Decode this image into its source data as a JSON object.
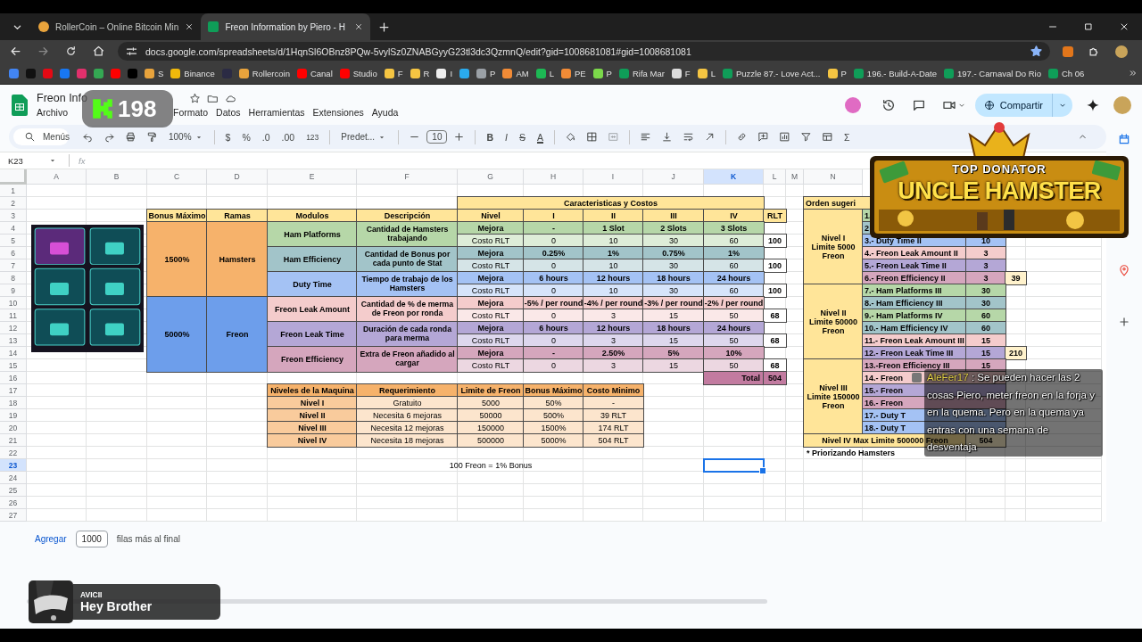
{
  "browser": {
    "tabs": [
      {
        "title": "RollerCoin – Online Bitcoin Min",
        "selected": false
      },
      {
        "title": "Freon Information by Piero - H",
        "selected": true
      }
    ],
    "url": "docs.google.com/spreadsheets/d/1HqnSl6OBnz8PQw-5vylSz0ZNABGyyG23tl3dc3QzmnQ/edit?gid=1008681081#gid=1008681081",
    "bookmarks": [
      {
        "color": "#4285f4"
      },
      {
        "color": "#111111"
      },
      {
        "color": "#e50914"
      },
      {
        "color": "#1877f2"
      },
      {
        "color": "#e1306c"
      },
      {
        "color": "#34a853"
      },
      {
        "color": "#ff0000"
      },
      {
        "color": "#000000"
      },
      {
        "label": "S",
        "color": "#e8a33c"
      },
      {
        "label": "Binance",
        "color": "#f0b90b"
      },
      {
        "color": "#2b2b44"
      },
      {
        "label": "Rollercoin",
        "color": "#e8a33c"
      },
      {
        "label": "Canal",
        "color": "#ff0000"
      },
      {
        "label": "Studio",
        "color": "#ff0000"
      },
      {
        "label": "F",
        "color": "#f5c542"
      },
      {
        "label": "R",
        "color": "#f5c542"
      },
      {
        "label": "I",
        "color": "#eeeeee"
      },
      {
        "color": "#2aabee"
      },
      {
        "label": "P",
        "color": "#9aa0a6"
      },
      {
        "label": "AM",
        "color": "#f28b36"
      },
      {
        "label": "L",
        "color": "#1db954"
      },
      {
        "label": "PE",
        "color": "#f28b36"
      },
      {
        "label": "P",
        "color": "#7bd84a"
      },
      {
        "label": "Rifa Mar",
        "color": "#0f9d58"
      },
      {
        "label": "F",
        "color": "#dddddd"
      },
      {
        "label": "L",
        "color": "#f5c542"
      },
      {
        "label": "Puzzle 87.- Love Act...",
        "color": "#0f9d58"
      },
      {
        "label": "P",
        "color": "#f5c542"
      },
      {
        "label": "196.- Build-A-Date",
        "color": "#0f9d58"
      },
      {
        "label": "197.- Carnaval Do Rio",
        "color": "#0f9d58"
      },
      {
        "label": "Ch 06",
        "color": "#0f9d58"
      }
    ]
  },
  "doc": {
    "title": "Freon Info",
    "menus": [
      "Archivo",
      "Formato",
      "Datos",
      "Herramientas",
      "Extensiones",
      "Ayuda"
    ],
    "share_button": "Compartir"
  },
  "toolbar": {
    "search": "Menús",
    "zoom": "100%",
    "currency": "$",
    "percent": "%",
    "decrease_decimals": ".0",
    "increase_decimals": ".00",
    "number_format": "123",
    "font": "Predet...",
    "font_size": "10",
    "bold": "B",
    "italic": "I",
    "strikethrough": "S",
    "text_color": "A",
    "functions": "Σ"
  },
  "formula_bar": {
    "name_box": "K23",
    "formula_label": "fx"
  },
  "sheet": {
    "columns": [
      {
        "label": "A",
        "selected": false
      },
      {
        "label": "B",
        "selected": false
      },
      {
        "label": "C",
        "selected": false
      },
      {
        "label": "D",
        "selected": false
      },
      {
        "label": "E",
        "selected": false
      },
      {
        "label": "F",
        "selected": false
      },
      {
        "label": "G",
        "selected": false
      },
      {
        "label": "H",
        "selected": false
      },
      {
        "label": "I",
        "selected": false
      },
      {
        "label": "J",
        "selected": false
      },
      {
        "label": "K",
        "selected": true
      },
      {
        "label": "L",
        "selected": false
      },
      {
        "label": "M",
        "selected": false
      },
      {
        "label": "N",
        "selected": false
      }
    ],
    "rows": [
      {
        "label": "1",
        "selected": false
      },
      {
        "label": "2",
        "selected": false
      },
      {
        "label": "3",
        "selected": false
      },
      {
        "label": "4",
        "selected": false
      },
      {
        "label": "5",
        "selected": false
      },
      {
        "label": "6",
        "selected": false
      },
      {
        "label": "7",
        "selected": false
      },
      {
        "label": "8",
        "selected": false
      },
      {
        "label": "9",
        "selected": false
      },
      {
        "label": "10",
        "selected": false
      },
      {
        "label": "11",
        "selected": false
      },
      {
        "label": "12",
        "selected": false
      },
      {
        "label": "13",
        "selected": false
      },
      {
        "label": "14",
        "selected": false
      },
      {
        "label": "15",
        "selected": false
      },
      {
        "label": "16",
        "selected": false
      },
      {
        "label": "17",
        "selected": false
      },
      {
        "label": "18",
        "selected": false
      },
      {
        "label": "19",
        "selected": false
      },
      {
        "label": "20",
        "selected": false
      },
      {
        "label": "21",
        "selected": false
      },
      {
        "label": "22",
        "selected": false
      },
      {
        "label": "23",
        "selected": true
      },
      {
        "label": "24",
        "selected": false
      },
      {
        "label": "25",
        "selected": false
      },
      {
        "label": "26",
        "selected": false
      },
      {
        "label": "27",
        "selected": false
      }
    ]
  },
  "main_table": {
    "title": "Caracteristicas y Costos",
    "columns": [
      "Bonus Máximo",
      "Ramas",
      "Modulos",
      "Descripción",
      "Nivel",
      "I",
      "II",
      "III",
      "IV",
      "RLT"
    ],
    "branches": [
      {
        "bonus": "1500%",
        "name": "Hamsters",
        "color": "#f6b26b",
        "modules": [
          {
            "name": "Ham Platforms",
            "description": "Cantidad de Hamsters trabajando",
            "color": "#b6d7a8",
            "upgrade_label": "Mejora",
            "upgrades": [
              "-",
              "1 Slot",
              "2 Slots",
              "3 Slots"
            ],
            "cost_label": "Costo RLT",
            "costs": [
              "0",
              "10",
              "30",
              "60"
            ],
            "total": "100"
          },
          {
            "name": "Ham Efficiency",
            "description": "Cantidad de Bonus por cada punto de Stat",
            "color": "#a2c4c9",
            "upgrade_label": "Mejora",
            "upgrades": [
              "0.25%",
              "1%",
              "0.75%",
              "1%"
            ],
            "cost_label": "Costo RLT",
            "costs": [
              "0",
              "10",
              "30",
              "60"
            ],
            "total": "100"
          },
          {
            "name": "Duty Time",
            "description": "Tiempo de trabajo de los Hamsters",
            "color": "#a4c2f4",
            "upgrade_label": "Mejora",
            "upgrades": [
              "6 hours",
              "12 hours",
              "18 hours",
              "24 hours"
            ],
            "cost_label": "Costo RLT",
            "costs": [
              "0",
              "10",
              "30",
              "60"
            ],
            "total": "100"
          }
        ]
      },
      {
        "bonus": "5000%",
        "name": "Freon",
        "color": "#6d9eeb",
        "modules": [
          {
            "name": "Freon Leak Amount",
            "description": "Cantidad de % de merma de Freon por ronda",
            "color": "#f4cccc",
            "upgrade_label": "Mejora",
            "upgrades": [
              "-5% / per round",
              "-4% / per round",
              "-3% / per round",
              "-2% / per round"
            ],
            "cost_label": "Costo RLT",
            "costs": [
              "0",
              "3",
              "15",
              "50"
            ],
            "total": "68"
          },
          {
            "name": "Freon Leak Time",
            "description": "Duración de cada ronda para merma",
            "color": "#b4a7d6",
            "upgrade_label": "Mejora",
            "upgrades": [
              "6 hours",
              "12 hours",
              "18 hours",
              "24 hours"
            ],
            "cost_label": "Costo RLT",
            "costs": [
              "0",
              "3",
              "15",
              "50"
            ],
            "total": "68"
          },
          {
            "name": "Freon Efficiency",
            "description": "Extra de Freon añadido al cargar",
            "color": "#d5a6bd",
            "upgrade_label": "Mejora",
            "upgrades": [
              "-",
              "2.50%",
              "5%",
              "10%"
            ],
            "cost_label": "Costo RLT",
            "costs": [
              "0",
              "3",
              "15",
              "50"
            ],
            "total": "68"
          }
        ]
      }
    ],
    "total_label": "Total",
    "total": "504"
  },
  "levels_table": {
    "columns": [
      "Niveles de la Maquina",
      "Requerimiento",
      "Limite de Freon",
      "Bonus Máximo",
      "Costo Minimo"
    ],
    "rows": [
      [
        "Nivel I",
        "Gratuito",
        "5000",
        "50%",
        "-"
      ],
      [
        "Nivel II",
        "Necesita 6 mejoras",
        "50000",
        "500%",
        "39 RLT"
      ],
      [
        "Nivel III",
        "Necesita 12 mejoras",
        "150000",
        "1500%",
        "174 RLT"
      ],
      [
        "Nivel IV",
        "Necesita 18 mejoras",
        "500000",
        "5000%",
        "504 RLT"
      ]
    ]
  },
  "note": "100 Freon = 1% Bonus",
  "order_table": {
    "title": "Orden sugeri",
    "groups": [
      {
        "label": [
          "Nivel I",
          "Limite 5000",
          "Freon"
        ],
        "subtotal": "39",
        "items": [
          {
            "text": "1.",
            "color": "#b6d7a8"
          },
          {
            "text": "2",
            "color": "#a2c4c9"
          },
          {
            "text": "3.- Duty Time II",
            "cost": "10",
            "color": "#a4c2f4"
          },
          {
            "text": "4.- Freon Leak Amount II",
            "cost": "3",
            "color": "#f4cccc"
          },
          {
            "text": "5.- Freon Leak Time II",
            "cost": "3",
            "color": "#b4a7d6"
          },
          {
            "text": "6.- Freon Efficiency II",
            "cost": "3",
            "color": "#d5a6bd"
          }
        ]
      },
      {
        "label": [
          "Nivel II",
          "Limite 50000",
          "Freon"
        ],
        "subtotal": "210",
        "items": [
          {
            "text": "7.- Ham Platforms III",
            "cost": "30",
            "color": "#b6d7a8"
          },
          {
            "text": "8.- Ham Efficiency III",
            "cost": "30",
            "color": "#a2c4c9"
          },
          {
            "text": "9.- Ham Platforms IV",
            "cost": "60",
            "color": "#b6d7a8"
          },
          {
            "text": "10.- Ham Efficiency IV",
            "cost": "60",
            "color": "#a2c4c9"
          },
          {
            "text": "11.- Freon Leak Amount III",
            "cost": "15",
            "color": "#f4cccc"
          },
          {
            "text": "12.- Freon Leak Time III",
            "cost": "15",
            "color": "#b4a7d6"
          }
        ]
      },
      {
        "label": [
          "Nivel III",
          "Limite 150000",
          "Freon"
        ],
        "items": [
          {
            "text": "13.-Freon Efficiency III",
            "cost": "15",
            "color": "#d5a6bd"
          },
          {
            "text": "14.- Freon",
            "color": "#f4cccc"
          },
          {
            "text": "15.- Freon",
            "color": "#b4a7d6"
          },
          {
            "text": "16.- Freon",
            "color": "#d5a6bd"
          },
          {
            "text": "17.- Duty T",
            "color": "#a4c2f4"
          },
          {
            "text": "18.- Duty T",
            "color": "#a4c2f4"
          }
        ]
      }
    ],
    "footer_label": "Nivel IV Max Limite 500000 Freon",
    "footer_total": "504",
    "note": "* Priorizando Hamsters"
  },
  "footer": {
    "add_button": "Agregar",
    "rows_count": "1000",
    "suffix": "filas más al final"
  },
  "overlays": {
    "viewer_count": "198",
    "banner": {
      "label": "TOP DONATOR",
      "title": "UNCLE HAMSTER"
    },
    "chat": {
      "user": "AleFer17",
      "message": ": Se pueden hacer las 2 cosas Piero, meter freon en la forja y en la quema. Pero en la quema ya entras con una semana de desventaja"
    },
    "now_playing": {
      "artist": "AVICII",
      "title": "Hey Brother"
    }
  }
}
